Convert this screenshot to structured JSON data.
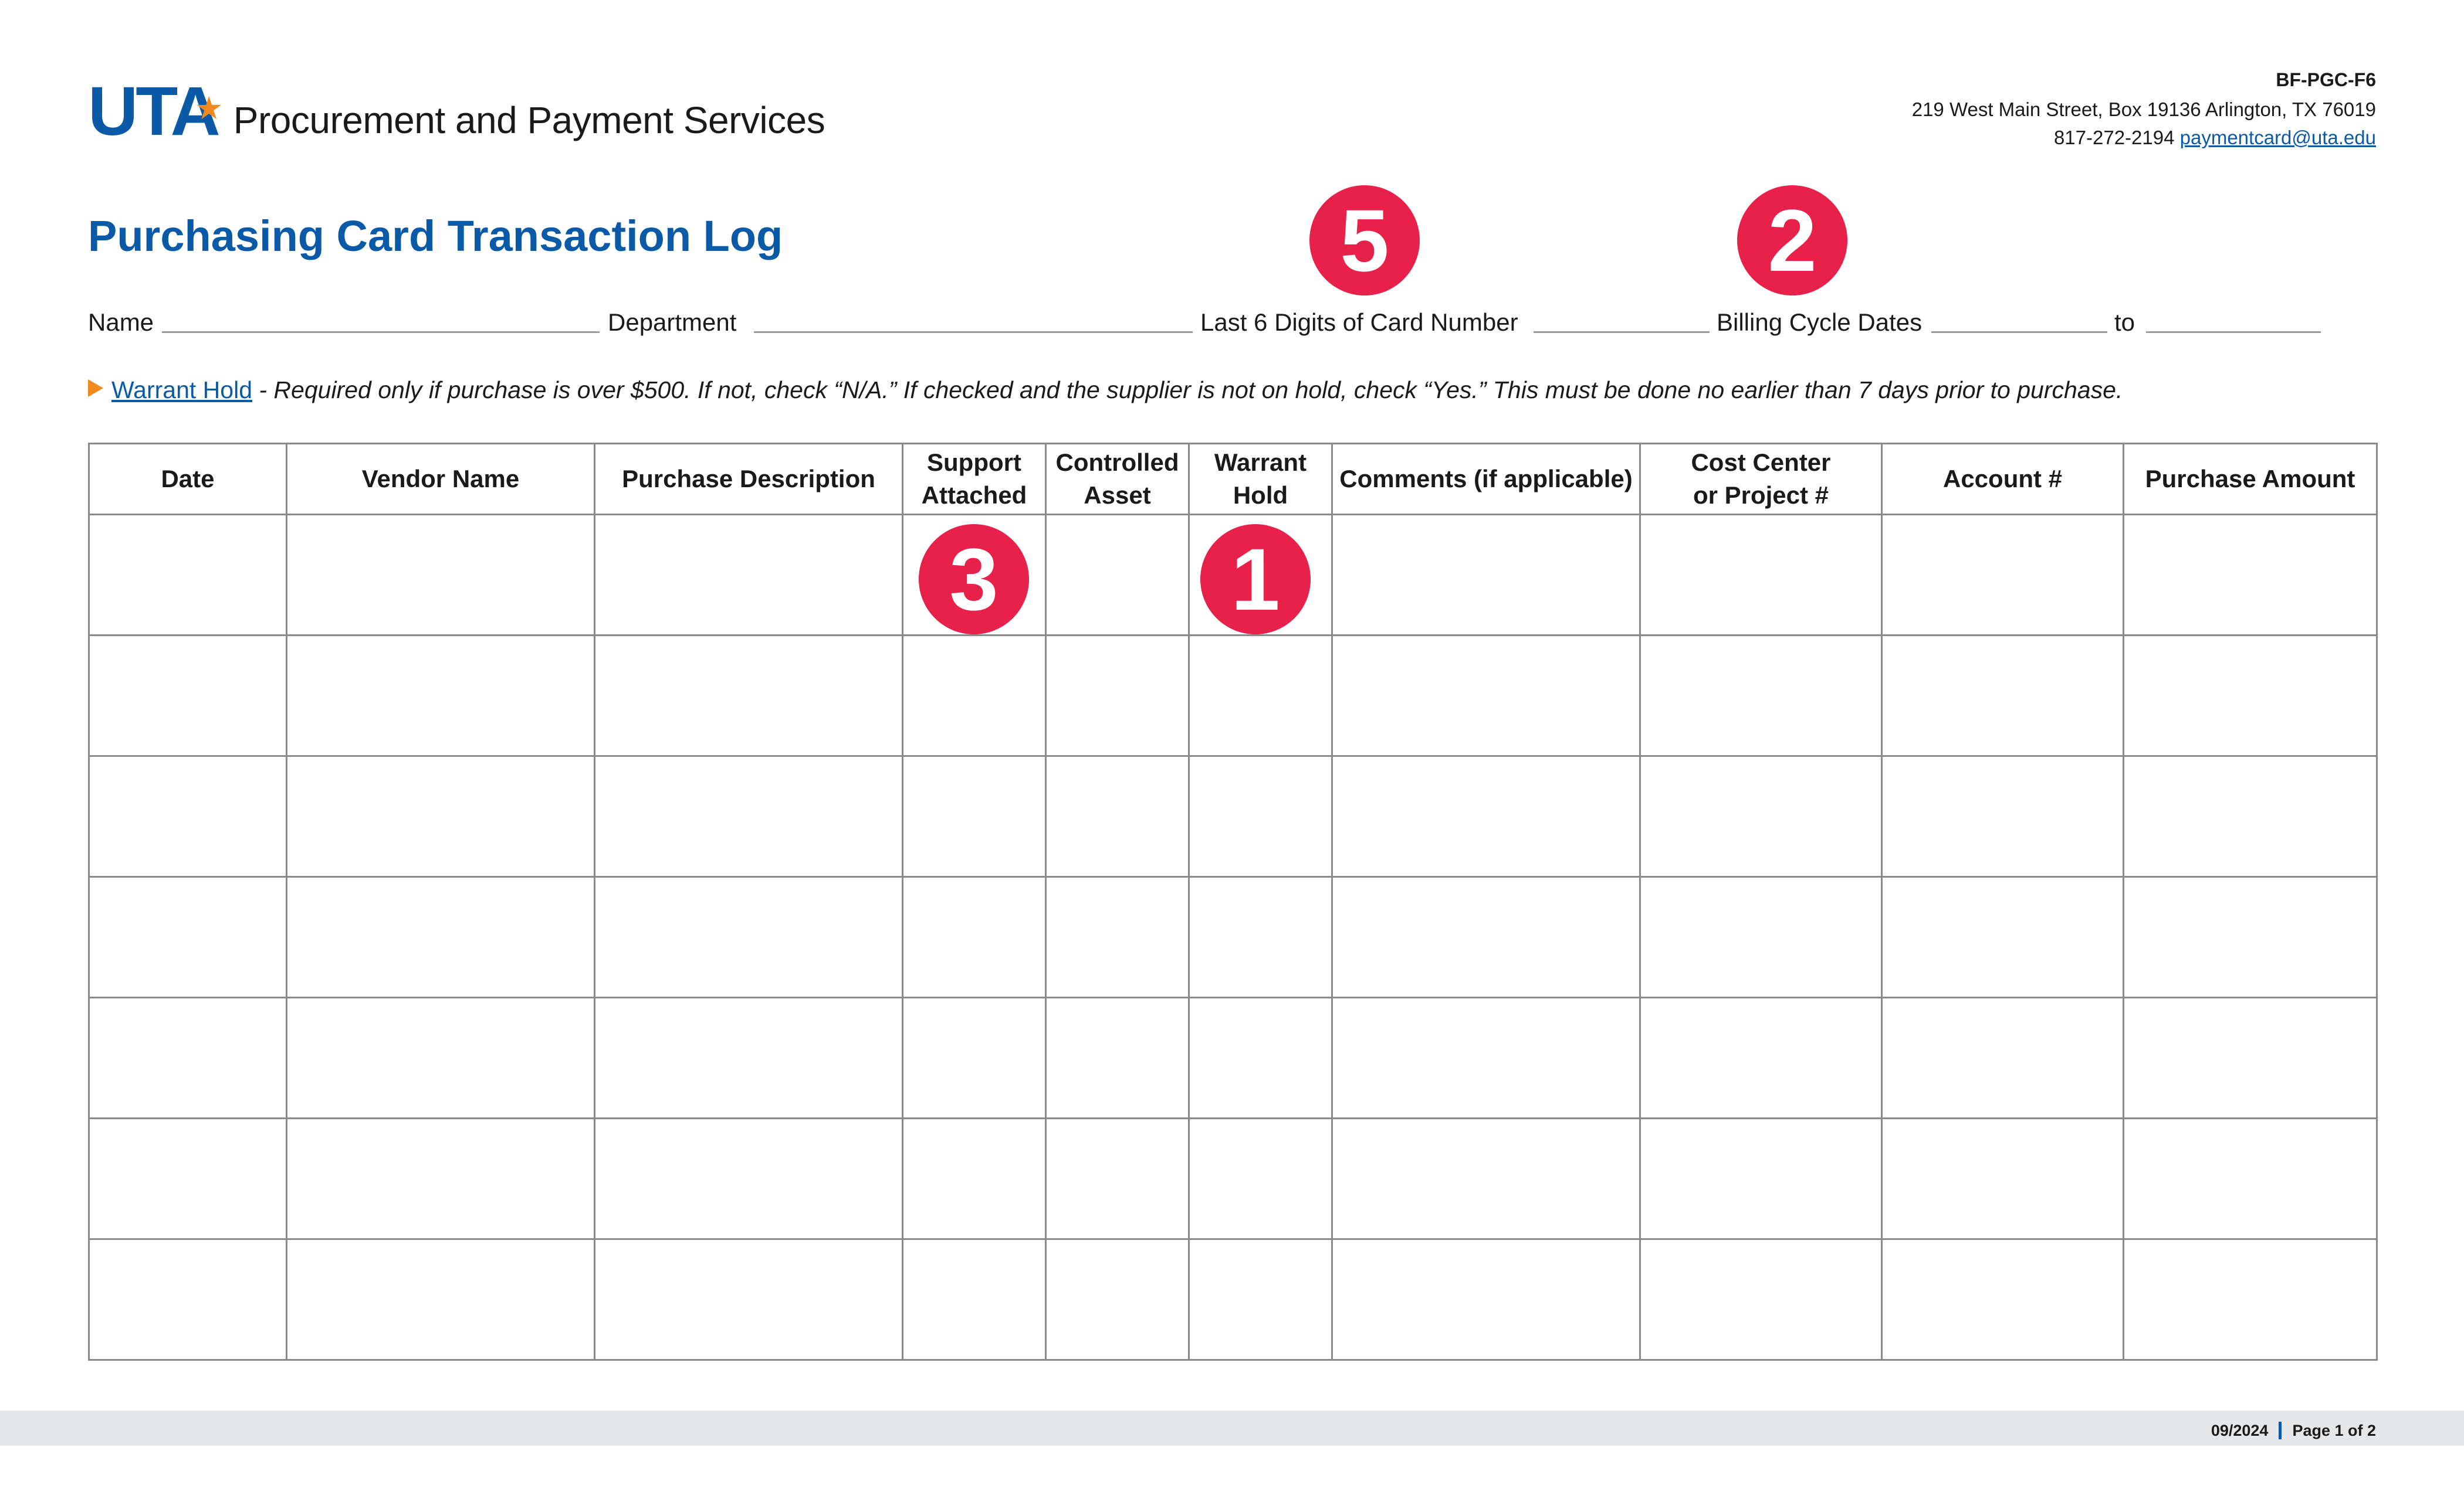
{
  "header": {
    "logo_mark": "UTA",
    "logo_text": "Procurement and Payment Services",
    "form_id": "BF-PGC-F6",
    "address": "219 West Main Street, Box 19136 Arlington, TX 76019",
    "phone": "817-272-2194",
    "email": "paymentcard@uta.edu"
  },
  "title": "Purchasing Card Transaction Log",
  "fields": {
    "name": "Name",
    "department": "Department",
    "card_digits": "Last 6 Digits of Card Number",
    "billing": "Billing Cycle Dates",
    "to": "to"
  },
  "badges": [
    "5",
    "2",
    "3",
    "1"
  ],
  "note": {
    "link": "Warrant Hold",
    "text": " - Required only if purchase is over $500. If not, check “N/A.” If checked and the supplier is not on hold, check “Yes.” This must be done no earlier than 7 days prior to purchase."
  },
  "table": {
    "headers": [
      [
        "Date"
      ],
      [
        "Vendor Name"
      ],
      [
        "Purchase Description"
      ],
      [
        "Support",
        "Attached"
      ],
      [
        "Controlled",
        "Asset"
      ],
      [
        "Warrant",
        "Hold"
      ],
      [
        "Comments (if applicable)"
      ],
      [
        "Cost Center",
        "or Project #"
      ],
      [
        "Account #"
      ],
      [
        "Purchase Amount"
      ]
    ],
    "row_count": 7
  },
  "footer": {
    "date": "09/2024",
    "page": "Page 1 of 2"
  }
}
